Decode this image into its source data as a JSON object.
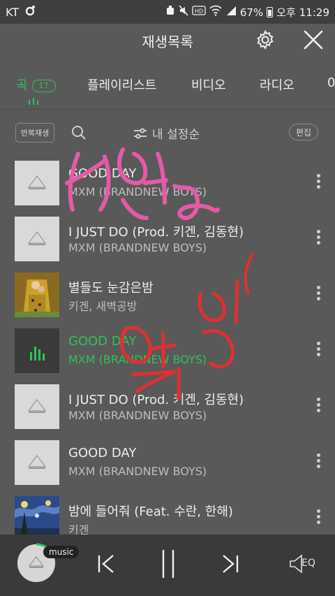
{
  "status_bar": {
    "carrier": "KT",
    "battery": "67%",
    "ampm": "오후",
    "time": "11:29"
  },
  "header": {
    "title": "재생목록"
  },
  "tabs": [
    {
      "label": "곡",
      "count": "17",
      "active": true
    },
    {
      "label": "플레이리스트"
    },
    {
      "label": "비디오"
    },
    {
      "label": "라디오"
    },
    {
      "label": "0"
    }
  ],
  "toolbar": {
    "repeat_label": "반복재생",
    "sort_label": "내 설정순",
    "edit_label": "편집"
  },
  "tracks": [
    {
      "title": "GOOD DAY",
      "artist": "MXM (BRANDNEW BOYS)"
    },
    {
      "title": "I JUST DO (Prod. 키겐, 김동현)",
      "artist": "MXM (BRANDNEW BOYS)"
    },
    {
      "title": "별들도 눈감은밤",
      "artist": "키겐, 새벽공방"
    },
    {
      "title": "GOOD DAY",
      "artist": "MXM (BRANDNEW BOYS)",
      "playing": true
    },
    {
      "title": "I JUST DO (Prod. 키겐, 김동현)",
      "artist": "MXM (BRANDNEW BOYS)"
    },
    {
      "title": "GOOD DAY",
      "artist": "MXM (BRANDNEW BOYS)"
    },
    {
      "title": "밤에 들어줘 (Feat. 수란, 한해)",
      "artist": "키겐"
    }
  ],
  "player": {
    "tag": "music",
    "eq_label": "EQ"
  },
  "colors": {
    "accent": "#2ec25a",
    "scribble_pink": "#e55aa8",
    "scribble_red": "#e03030"
  }
}
